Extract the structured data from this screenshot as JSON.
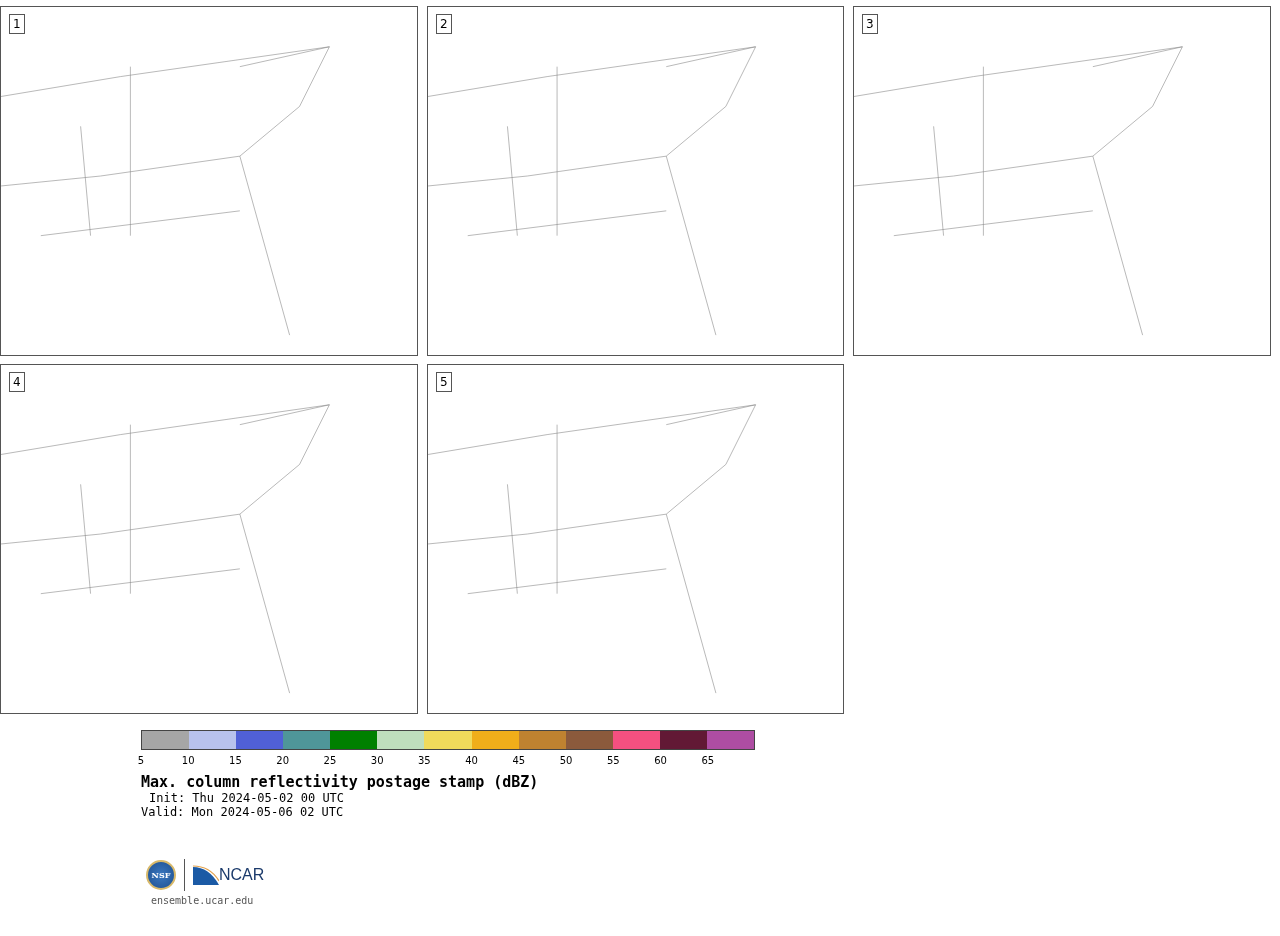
{
  "panels": [
    {
      "number": "1"
    },
    {
      "number": "2"
    },
    {
      "number": "3"
    },
    {
      "number": "4"
    },
    {
      "number": "5"
    }
  ],
  "colorbar": {
    "bins": [
      {
        "color": "#a6a6a6",
        "label": "5"
      },
      {
        "color": "#b8c2ec",
        "label": "10"
      },
      {
        "color": "#5060d6",
        "label": "15"
      },
      {
        "color": "#4f9699",
        "label": "20"
      },
      {
        "color": "#008000",
        "label": "25"
      },
      {
        "color": "#bfdebd",
        "label": "30"
      },
      {
        "color": "#f0da5b",
        "label": "35"
      },
      {
        "color": "#f0ae1a",
        "label": "40"
      },
      {
        "color": "#bf8230",
        "label": "45"
      },
      {
        "color": "#8b5a3c",
        "label": "50"
      },
      {
        "color": "#f55080",
        "label": "55"
      },
      {
        "color": "#621935",
        "label": "60"
      },
      {
        "color": "#ae4da3",
        "label": "65"
      }
    ]
  },
  "title": "Max. column reflectivity postage stamp (dBZ)",
  "init": "Init: Thu 2024-05-02 00 UTC",
  "valid": "Valid: Mon 2024-05-06 02 UTC",
  "logo": {
    "nsf": "NSF",
    "ncar": "NCAR"
  },
  "site": "ensemble.ucar.edu"
}
